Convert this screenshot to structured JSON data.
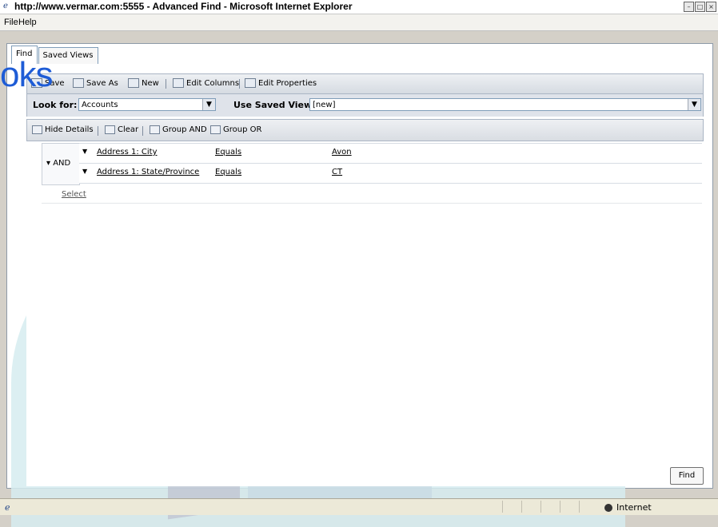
{
  "window": {
    "title": "http://www.vermar.com:5555 - Advanced Find - Microsoft Internet Explorer",
    "icon": "ie-icon",
    "controls": [
      "minimize",
      "maximize",
      "close"
    ]
  },
  "menu": {
    "file": "File",
    "help": "Help"
  },
  "tabs": [
    {
      "label": "Find",
      "active": true
    },
    {
      "label": "Saved Views",
      "active": false
    }
  ],
  "toolbar": {
    "save": "Save",
    "save_as": "Save As",
    "new": "New",
    "edit_columns": "Edit Columns",
    "edit_properties": "Edit Properties"
  },
  "look_for": {
    "label": "Look for:",
    "value": "Accounts",
    "saved_view_label": "Use Saved View:",
    "saved_view_value": "[new]"
  },
  "toolbar2": {
    "hide_details": "Hide Details",
    "clear": "Clear",
    "group_and": "Group AND",
    "group_or": "Group OR"
  },
  "criteria": {
    "group_label": "AND",
    "rows": [
      {
        "field": "Address 1: City",
        "operator": "Equals",
        "value": "Avon"
      },
      {
        "field": "Address 1: State/Province",
        "operator": "Equals",
        "value": "CT"
      }
    ],
    "select_label": "Select"
  },
  "find_button": "Find",
  "status": {
    "zone": "Internet"
  },
  "watermark": {
    "logo_text": "oks",
    "word": "DropBooks"
  },
  "colors": {
    "logo": "#1e5cd6",
    "overlay": "#d6ecf0"
  }
}
